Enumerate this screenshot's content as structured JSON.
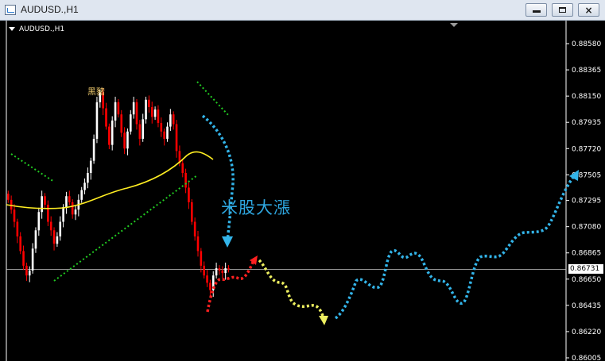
{
  "window": {
    "title": "AUDUSD.,H1",
    "buttons": {
      "minimize": "minimize",
      "maximize": "maximize",
      "close": "×"
    }
  },
  "chart": {
    "label": "AUDUSD.,H1",
    "annotation": "米股大漲",
    "marker": "黑豬",
    "current_price": "0.86731",
    "colors": {
      "background": "#000000",
      "bull": "#ffffff",
      "bear": "#ff0000",
      "ma": "#ffee22",
      "channel": "#22cc22",
      "forecast_blue": "#33b5ea",
      "forecast_red": "#ff2020",
      "forecast_yellow": "#eef060"
    }
  },
  "chart_data": {
    "type": "candlestick",
    "symbol": "AUDUSD.",
    "timeframe": "H1",
    "y_ticks": [
      "0.88580",
      "0.88365",
      "0.88150",
      "0.87935",
      "0.87720",
      "0.87505",
      "0.87295",
      "0.87080",
      "0.86865",
      "0.86650",
      "0.86435",
      "0.86220",
      "0.86005"
    ],
    "ylim": [
      0.86005,
      0.888
    ],
    "current_price": 0.86731
  }
}
